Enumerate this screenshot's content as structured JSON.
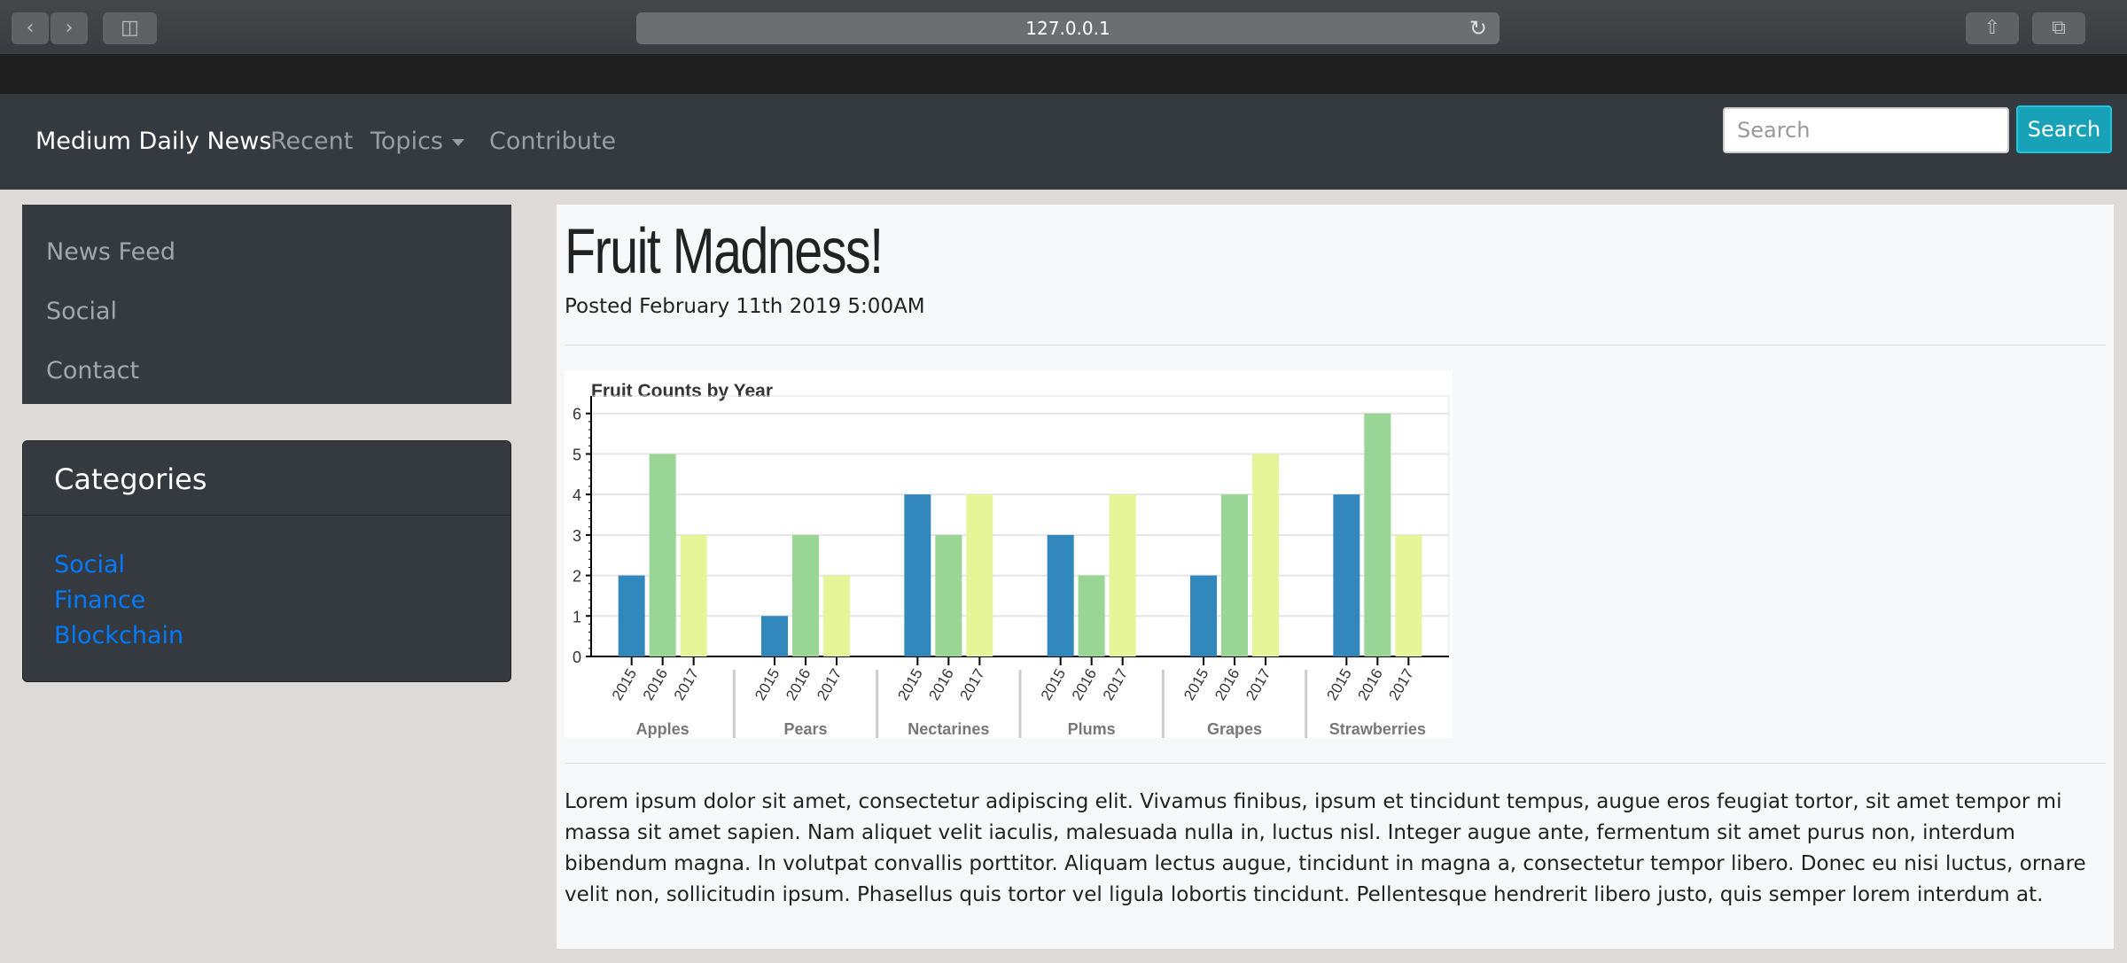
{
  "browser": {
    "url": "127.0.0.1"
  },
  "navbar": {
    "brand": "Medium Daily News",
    "links": [
      "Recent",
      "Topics",
      "Contribute"
    ],
    "search_placeholder": "Search",
    "search_button": "Search"
  },
  "sidebar": {
    "items": [
      "News Feed",
      "Social",
      "Contact"
    ]
  },
  "categories": {
    "title": "Categories",
    "items": [
      "Social",
      "Finance",
      "Blockchain"
    ]
  },
  "article": {
    "title": "Fruit Madness!",
    "posted": "Posted February 11th 2019 5:00AM",
    "body": "Lorem ipsum dolor sit amet, consectetur adipiscing elit. Vivamus finibus, ipsum et tincidunt tempus, augue eros feugiat tortor, sit amet tempor mi massa sit amet sapien. Nam aliquet velit iaculis, malesuada nulla in, luctus nisl. Integer augue ante, fermentum sit amet purus non, interdum bibendum magna. In volutpat convallis porttitor. Aliquam lectus augue, tincidunt in magna a, consectetur tempor libero. Donec eu nisi luctus, ornare velit non, sollicitudin ipsum. Phasellus quis tortor vel ligula lobortis tincidunt. Pellentesque hendrerit libero justo, quis semper lorem interdum at."
  },
  "chart_data": {
    "type": "bar",
    "title": "Fruit Counts by Year",
    "categories": [
      "Apples",
      "Pears",
      "Nectarines",
      "Plums",
      "Grapes",
      "Strawberries"
    ],
    "subcategories": [
      "2015",
      "2016",
      "2017"
    ],
    "colors": [
      "#3288bd",
      "#99d594",
      "#e6f598"
    ],
    "series": [
      {
        "name": "2015",
        "values": [
          2,
          1,
          4,
          3,
          2,
          4
        ]
      },
      {
        "name": "2016",
        "values": [
          5,
          3,
          3,
          2,
          4,
          6
        ]
      },
      {
        "name": "2017",
        "values": [
          3,
          2,
          4,
          4,
          5,
          3
        ]
      }
    ],
    "ylim": [
      0,
      6.3
    ],
    "yticks": [
      0,
      1,
      2,
      3,
      4,
      5,
      6
    ],
    "grid": true
  }
}
